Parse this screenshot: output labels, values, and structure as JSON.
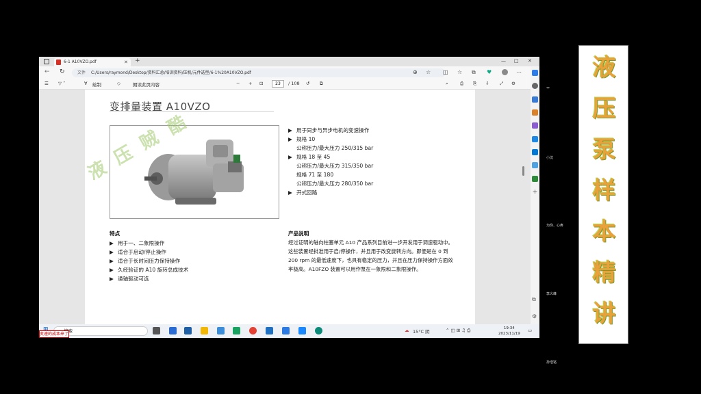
{
  "browser": {
    "tab_title": "6-1 A10VZO.pdf",
    "file_label": "文件",
    "url": "C:/Users/raymond/Desktop/资料汇总/培训资料/压机/元件选型/6-1%20A10VZO.pdf",
    "window_controls": [
      "—",
      "□",
      "✕"
    ]
  },
  "pdf_toolbar": {
    "draw_label": "绘制",
    "read_aloud_label": "朗读此页内容",
    "minus": "−",
    "plus": "+",
    "page_current": "23",
    "page_total": "/ 108"
  },
  "page": {
    "title": "变排量装置 A10VZO",
    "watermark": [
      "液",
      "压",
      "贼",
      "酷"
    ],
    "right_bullets": [
      {
        "marker": "▶",
        "text": "用于同步与异步电机的变速操作"
      },
      {
        "marker": "▶",
        "text": "规格 10"
      },
      {
        "marker": "",
        "text": "公称压力/最大压力 250/315 bar"
      },
      {
        "marker": "▶",
        "text": "规格 18 至 45"
      },
      {
        "marker": "",
        "text": "公称压力/最大压力 315/350 bar"
      },
      {
        "marker": "",
        "text": "规格 71 至 180"
      },
      {
        "marker": "",
        "text": "公称压力/最大压力 280/350 bar"
      },
      {
        "marker": "▶",
        "text": "开式回路"
      }
    ],
    "features_heading": "特点",
    "features": [
      "用于一、二象限操作",
      "适合于启动/停止操作",
      "适合于长时间压力保持操作",
      "久经验证的 A10 旋转总成技术",
      "通轴驱动可选"
    ],
    "desc_heading": "产品说明",
    "description": "经过证明的轴向柱塞单元 A10 产品系列目前进一步开发用于调速驱动中。这些装置经批准用于启/停操作，并且用于改变旋转方向。即便是在 0 到 200 rpm 的最低速度下，也具有稳定的压力，并且在压力保持操作方面效率极高。A10FZO 装置可以用作泵在一象限和二象限操作。"
  },
  "taskbar": {
    "search_placeholder": "搜索",
    "weather": "15°C 阴",
    "time": "19:34",
    "date": "2023/11/19"
  },
  "overlay": {
    "red_tag": "变速的成本来了",
    "side_labels": [
      "**",
      "小沈",
      "为你、心疼",
      "李义峰",
      "孙浩铭"
    ],
    "banner_chars": [
      "液",
      "压",
      "泵",
      "样",
      "本",
      "精",
      "讲"
    ]
  }
}
